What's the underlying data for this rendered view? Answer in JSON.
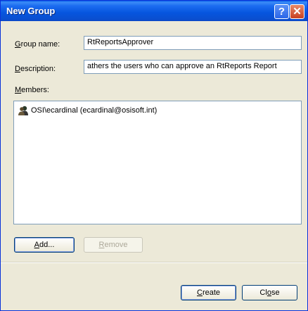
{
  "window": {
    "title": "New Group"
  },
  "titlebar": {
    "help_glyph": "?",
    "close_glyph": "✕"
  },
  "form": {
    "group_name_label_u": "G",
    "group_name_label_rest": "roup name:",
    "group_name_value": "RtReportsApprover",
    "description_label_u": "D",
    "description_label_rest": "escription:",
    "description_value": "athers the users who can approve an RtReports Report",
    "members_label_u": "M",
    "members_label_rest": "embers:"
  },
  "members": [
    {
      "name": "OSI\\ecardinal (ecardinal@osisoft.int)",
      "icon": "user-icon"
    }
  ],
  "buttons": {
    "add_u": "A",
    "add_rest": "dd...",
    "remove_u": "R",
    "remove_rest": "emove",
    "create_u": "C",
    "create_rest": "reate",
    "close_pre": "Cl",
    "close_u": "o",
    "close_rest": "se"
  }
}
